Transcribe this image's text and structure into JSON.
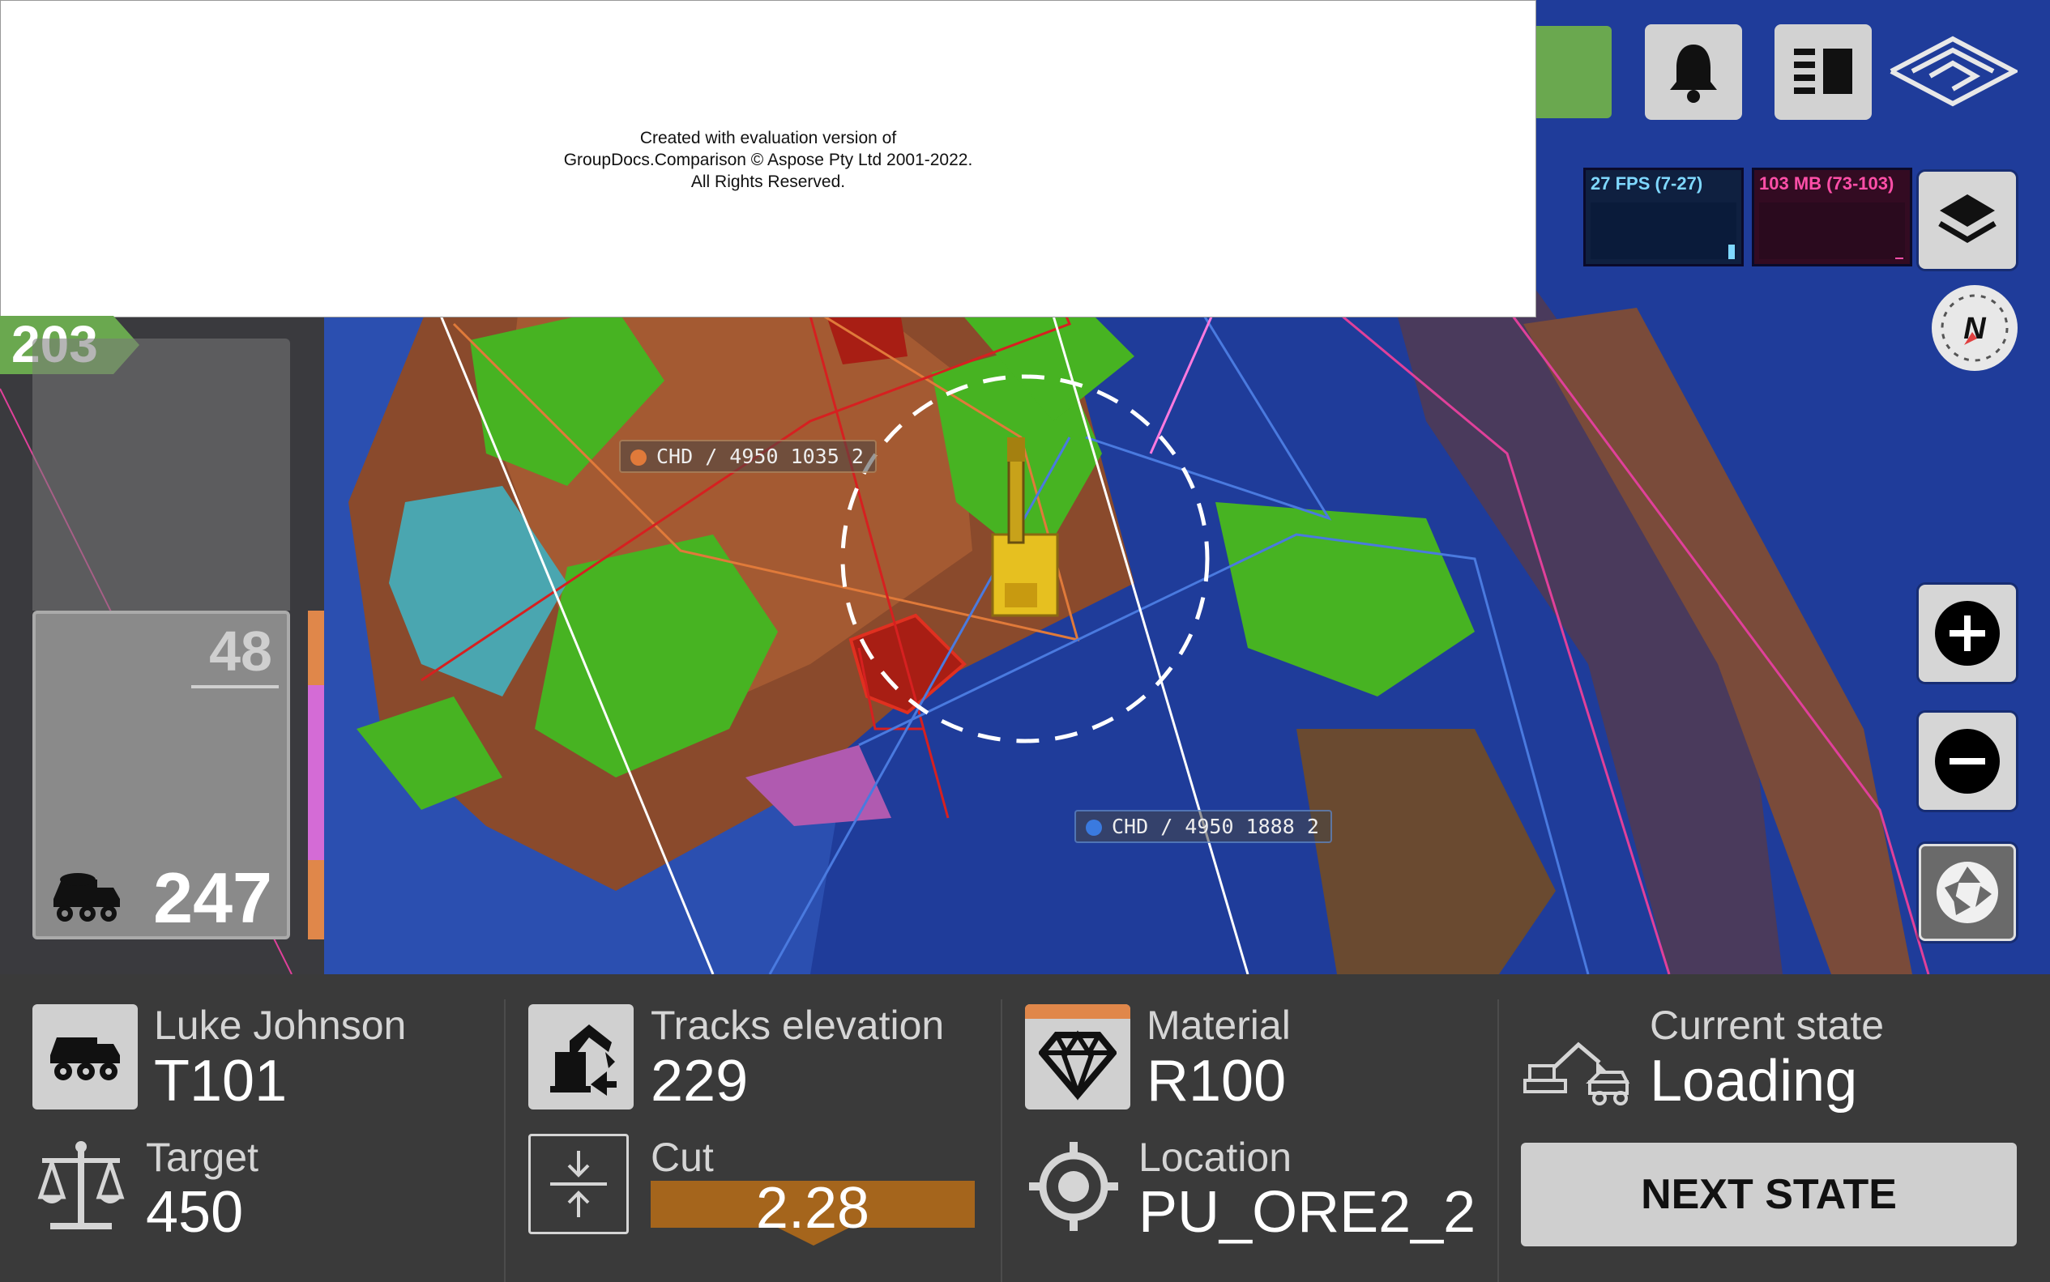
{
  "eval_notice": {
    "line1": "Created with evaluation version of",
    "line2": "GroupDocs.Comparison © Aspose Pty Ltd 2001-2022.",
    "line3": "All Rights Reserved."
  },
  "perf": {
    "fps": "27 FPS (7-27)",
    "mem": "103 MB (73-103)"
  },
  "compass": {
    "label": "N"
  },
  "map_labels": [
    {
      "text": "CHD / 4950 1035 2",
      "dot_color": "#e07a3a"
    },
    {
      "text": "CHD / 4950 1888 2",
      "dot_color": "#3a7ae0"
    }
  ],
  "left_panel": {
    "badge": "203",
    "secondary": "48",
    "primary": "247"
  },
  "operator": {
    "name": "Luke Johnson",
    "truck": "T101"
  },
  "target": {
    "label": "Target",
    "value": "450"
  },
  "tracks": {
    "label": "Tracks elevation",
    "value": "229"
  },
  "cut": {
    "label": "Cut",
    "value": "2.28"
  },
  "material": {
    "label": "Material",
    "value": "R100"
  },
  "location": {
    "label": "Location",
    "value": "PU_ORE2_2"
  },
  "state": {
    "label": "Current state",
    "value": "Loading",
    "next_button": "NEXT STATE"
  },
  "colors": {
    "accent_green": "#6aa84f",
    "cut_bar": "#a5651c",
    "material_accent": "#e0874a"
  }
}
